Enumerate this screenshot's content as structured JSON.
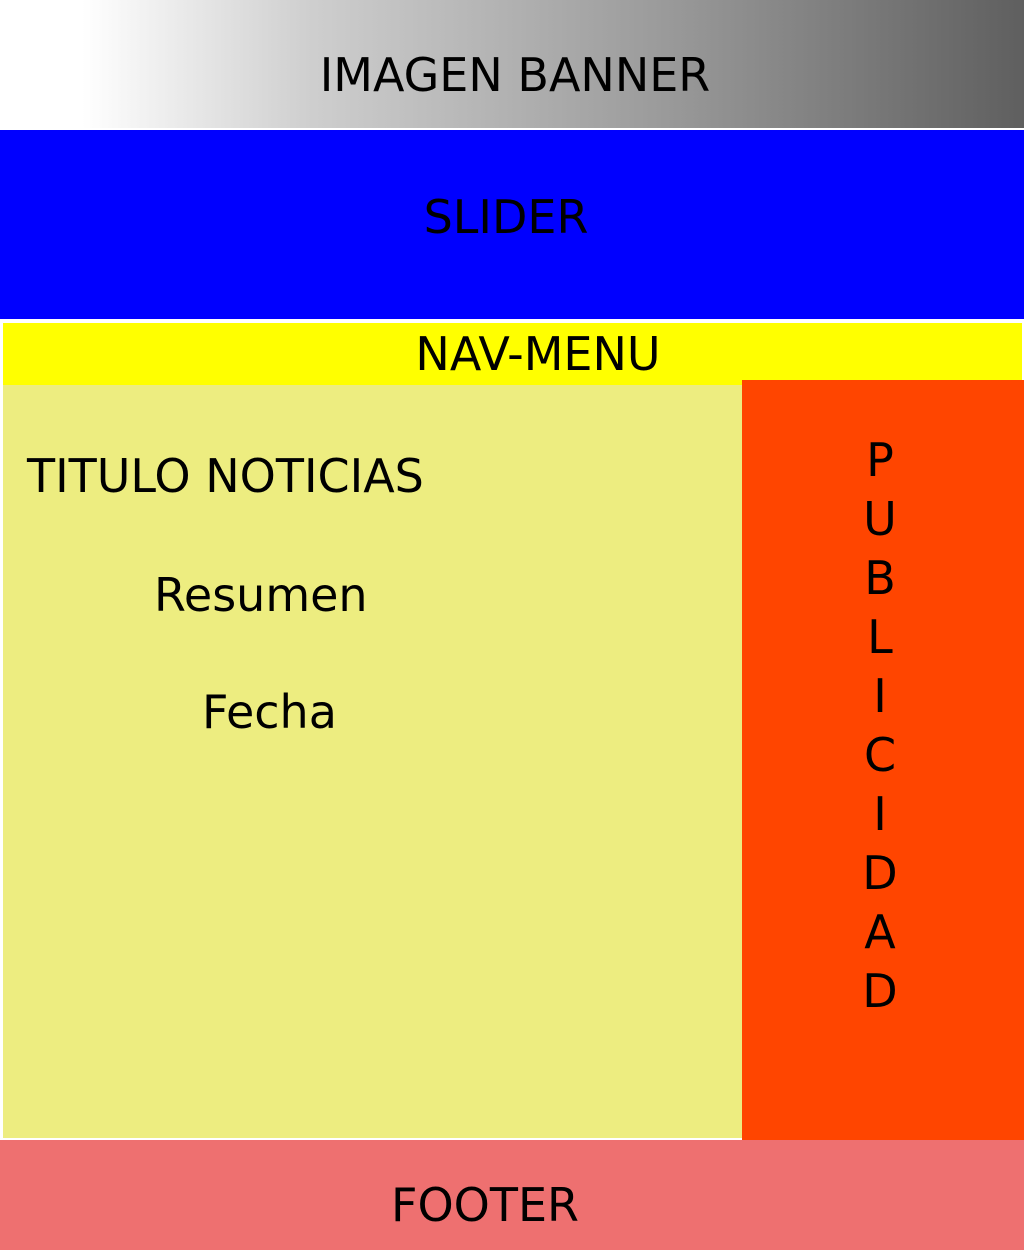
{
  "banner": {
    "label": "IMAGEN BANNER"
  },
  "slider": {
    "label": "SLIDER"
  },
  "nav": {
    "label": "NAV-MENU"
  },
  "main": {
    "title": "TITULO NOTICIAS",
    "summary": "Resumen",
    "date": "Fecha"
  },
  "ads": {
    "letters": [
      "P",
      "U",
      "B",
      "L",
      "I",
      "C",
      "I",
      "D",
      "A",
      "D"
    ]
  },
  "footer": {
    "label": "FOOTER"
  },
  "colors": {
    "slider": "#0000ff",
    "nav": "#ffff00",
    "main": "#eded80",
    "ads": "#ff4500",
    "footer": "#ee7070"
  }
}
